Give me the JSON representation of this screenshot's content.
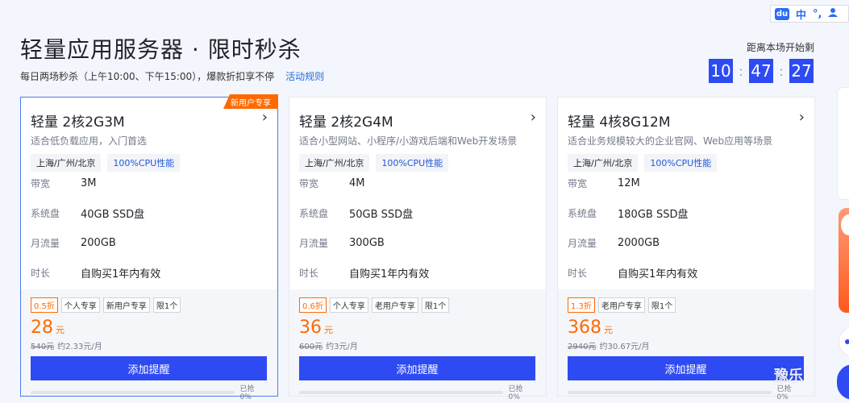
{
  "ime": {
    "logo": "du",
    "items": [
      "中",
      "°,"
    ],
    "icon": "user-icon"
  },
  "header": {
    "title": "轻量应用服务器 · 限时秒杀",
    "subtitle": "每日两场秒杀（上午10:00、下午15:00），爆款折扣享不停",
    "rules_link": "活动规则"
  },
  "countdown": {
    "label": "距离本场开始剩",
    "hours": "10",
    "minutes": "47",
    "seconds": "27",
    "sep": ":"
  },
  "spec_labels": {
    "bandwidth": "带宽",
    "disk": "系统盘",
    "traffic": "月流量",
    "duration": "时长"
  },
  "button_label": "添加提醒",
  "cards": [
    {
      "name": "轻量 2核2G3M",
      "desc": "适合低负载应用，入门首选",
      "badge": "新用户专享",
      "region": "上海/广州/北京",
      "cpu": "100%CPU性能",
      "bandwidth": "3M",
      "disk": "40GB SSD盘",
      "traffic": "200GB",
      "duration": "自购买1年内有效",
      "promo_tags": [
        "0.5折",
        "个人专享",
        "新用户专享",
        "限1个"
      ],
      "price": "28",
      "unit": "元",
      "orig_price": "540元",
      "monthly": "约2.33元/月",
      "sold": "已抢 0%",
      "progress": 0
    },
    {
      "name": "轻量 2核2G4M",
      "desc": "适合小型网站、小程序/小游戏后端和Web开发场景",
      "badge": "",
      "region": "上海/广州/北京",
      "cpu": "100%CPU性能",
      "bandwidth": "4M",
      "disk": "50GB SSD盘",
      "traffic": "300GB",
      "duration": "自购买1年内有效",
      "promo_tags": [
        "0.6折",
        "个人专享",
        "老用户专享",
        "限1个"
      ],
      "price": "36",
      "unit": "元",
      "orig_price": "600元",
      "monthly": "约3元/月",
      "sold": "已抢 0%",
      "progress": 0
    },
    {
      "name": "轻量 4核8G12M",
      "desc": "适合业务规模较大的企业官网、Web应用等场景",
      "badge": "",
      "region": "上海/广州/北京",
      "cpu": "100%CPU性能",
      "bandwidth": "12M",
      "disk": "180GB SSD盘",
      "traffic": "2000GB",
      "duration": "自购买1年内有效",
      "promo_tags": [
        "1.3折",
        "老用户专享",
        "限1个"
      ],
      "price": "368",
      "unit": "元",
      "orig_price": "2940元",
      "monthly": "约30.67元/月",
      "sold": "已抢 0%",
      "progress": 0
    }
  ],
  "watermark": "豫乐"
}
